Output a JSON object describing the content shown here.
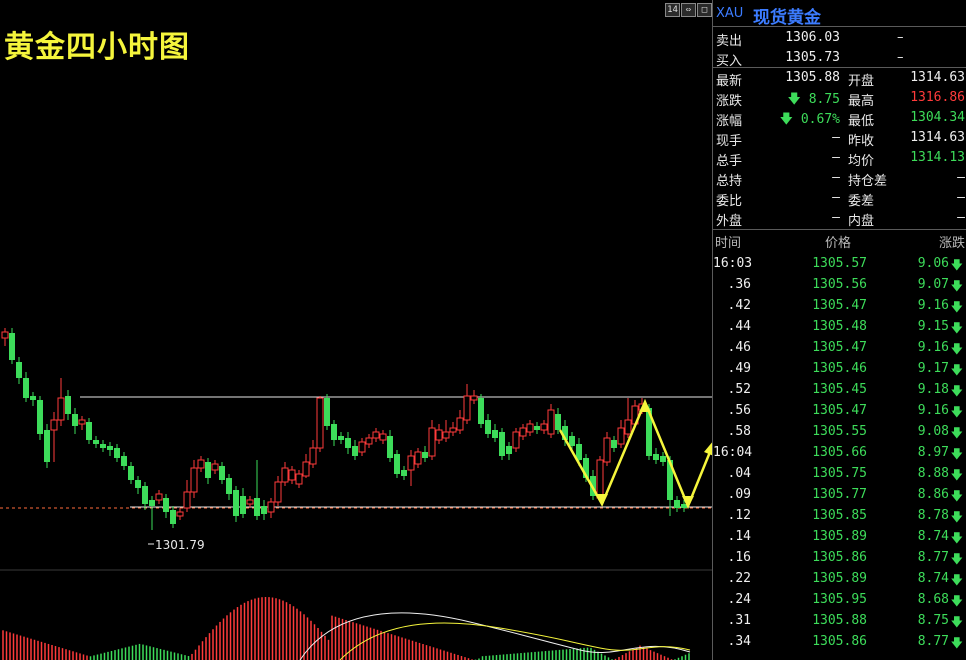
{
  "chart_title": "黄金四小时图",
  "low_marker": "1301.79",
  "window_buttons": [
    "14",
    "⇔",
    "□"
  ],
  "symbol": {
    "code": "XAU",
    "name": "现货黄金"
  },
  "quote": {
    "sell_label": "卖出",
    "sell": "1306.03",
    "sell_vol": "–",
    "buy_label": "买入",
    "buy": "1305.73",
    "buy_vol": "–",
    "latest_label": "最新",
    "latest": "1305.88",
    "open_label": "开盘",
    "open": "1314.63",
    "change_label": "涨跌",
    "change": "8.75",
    "high_label": "最高",
    "high": "1316.86",
    "pct_label": "涨幅",
    "pct": "0.67%",
    "low_label": "最低",
    "low": "1304.34",
    "cur_vol_label": "现手",
    "cur_vol": "–",
    "prev_close_label": "昨收",
    "prev_close": "1314.63",
    "total_vol_label": "总手",
    "total_vol": "–",
    "avg_label": "均价",
    "avg": "1314.13",
    "open_int_label": "总持",
    "open_int": "–",
    "oi_diff_label": "持仓差",
    "oi_diff": "–",
    "bid_ratio_label": "委比",
    "bid_ratio": "–",
    "bid_diff_label": "委差",
    "bid_diff": "–",
    "outer_label": "外盘",
    "outer": "–",
    "inner_label": "内盘",
    "inner": "–"
  },
  "trades_header": {
    "time": "时间",
    "price": "价格",
    "change": "涨跌"
  },
  "trades": [
    {
      "time": "16:03",
      "price": "1305.57",
      "change": "9.06"
    },
    {
      "time": ".36",
      "price": "1305.56",
      "change": "9.07"
    },
    {
      "time": ".42",
      "price": "1305.47",
      "change": "9.16"
    },
    {
      "time": ".44",
      "price": "1305.48",
      "change": "9.15"
    },
    {
      "time": ".46",
      "price": "1305.47",
      "change": "9.16"
    },
    {
      "time": ".49",
      "price": "1305.46",
      "change": "9.17"
    },
    {
      "time": ".52",
      "price": "1305.45",
      "change": "9.18"
    },
    {
      "time": ".56",
      "price": "1305.47",
      "change": "9.16"
    },
    {
      "time": ".58",
      "price": "1305.55",
      "change": "9.08"
    },
    {
      "time": "16:04",
      "price": "1305.66",
      "change": "8.97"
    },
    {
      "time": ".04",
      "price": "1305.75",
      "change": "8.88"
    },
    {
      "time": ".09",
      "price": "1305.77",
      "change": "8.86"
    },
    {
      "time": ".12",
      "price": "1305.85",
      "change": "8.78"
    },
    {
      "time": ".14",
      "price": "1305.89",
      "change": "8.74"
    },
    {
      "time": ".16",
      "price": "1305.86",
      "change": "8.77"
    },
    {
      "time": ".22",
      "price": "1305.89",
      "change": "8.74"
    },
    {
      "time": ".24",
      "price": "1305.95",
      "change": "8.68"
    },
    {
      "time": ".31",
      "price": "1305.88",
      "change": "8.75"
    },
    {
      "time": ".34",
      "price": "1305.86",
      "change": "8.77"
    }
  ],
  "colors": {
    "up": "#ff3b3b",
    "down": "#3ddc5a",
    "annotation": "#f5f53c",
    "title": "#f5f53c",
    "symbol": "#3c7cff"
  }
}
